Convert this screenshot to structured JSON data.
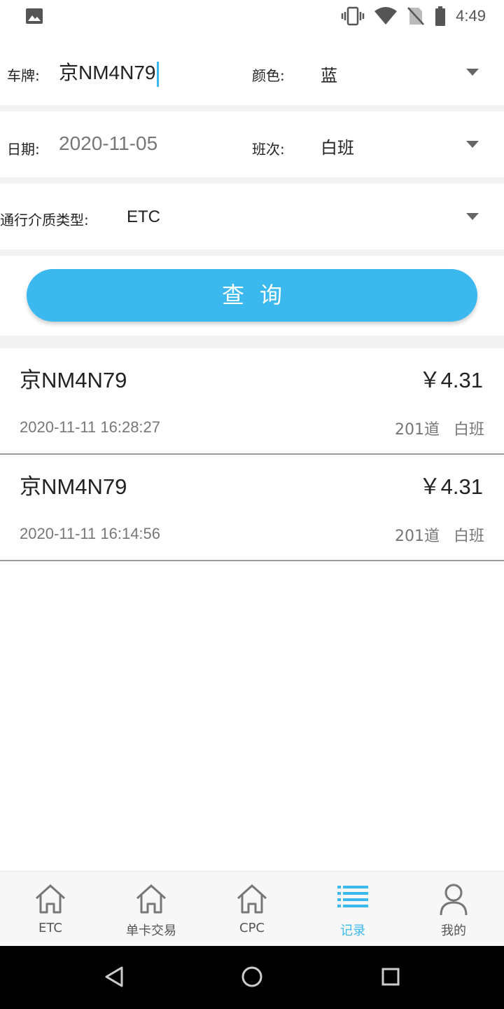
{
  "status_bar": {
    "time": "4:49",
    "left_icon": "image-icon",
    "right_icons": [
      "vibrate-icon",
      "wifi-icon",
      "no-sim-icon",
      "battery-icon"
    ]
  },
  "form": {
    "plate": {
      "label": "车牌:",
      "value": "京NM4N79"
    },
    "color": {
      "label": "颜色:",
      "value": "蓝"
    },
    "date": {
      "label": "日期:",
      "value": "2020-11-05"
    },
    "shift": {
      "label": "班次:",
      "value": "白班"
    },
    "medium": {
      "label": "通行介质类型:",
      "value": "ETC"
    }
  },
  "query_button": {
    "label": "查询"
  },
  "records": [
    {
      "plate": "京NM4N79",
      "amount": "￥4.31",
      "time": "2020-11-11 16:28:27",
      "lane": "201道",
      "shift": "白班"
    },
    {
      "plate": "京NM4N79",
      "amount": "￥4.31",
      "time": "2020-11-11 16:14:56",
      "lane": "201道",
      "shift": "白班"
    }
  ],
  "bottom_nav": {
    "active_color": "#3bb8ee",
    "items": [
      {
        "label": "ETC",
        "icon": "home-icon"
      },
      {
        "label": "单卡交易",
        "icon": "home-icon"
      },
      {
        "label": "CPC",
        "icon": "home-icon"
      },
      {
        "label": "记录",
        "icon": "list-icon",
        "active": true
      },
      {
        "label": "我的",
        "icon": "user-icon"
      }
    ]
  },
  "system_nav": {
    "buttons": [
      "back-icon",
      "home-circle-icon",
      "recents-icon"
    ]
  }
}
